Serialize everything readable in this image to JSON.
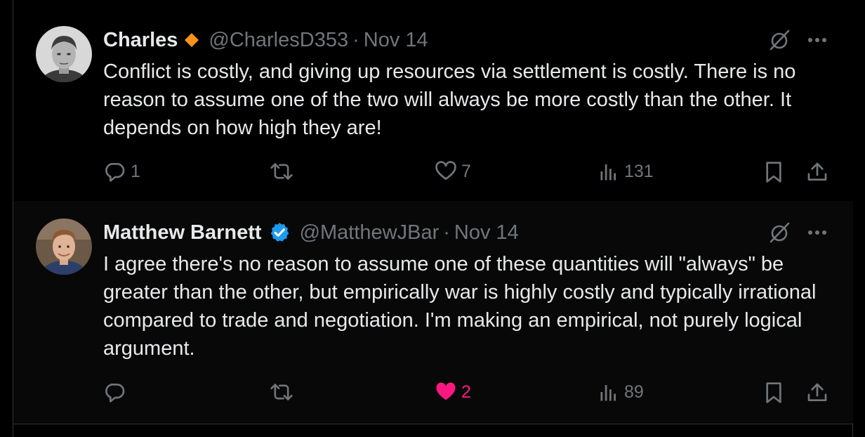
{
  "tweets": [
    {
      "name": "Charles",
      "badge": "orange-diamond-icon",
      "handle": "@CharlesD353",
      "separator": "·",
      "date": "Nov 14",
      "text": "Conflict is costly, and giving up resources via settlement is costly. There is no reason to assume one of the two will always be more costly than the other. It depends on how high they are!",
      "replies": "1",
      "reposts": "",
      "likes": "7",
      "views": "131",
      "liked": false
    },
    {
      "name": "Matthew Barnett",
      "badge": "verified-badge-icon",
      "handle": "@MatthewJBar",
      "separator": "·",
      "date": "Nov 14",
      "text": "I agree there's no reason to assume one of these quantities will \"always\" be greater than the other, but empirically war is highly costly and typically irrational compared to trade and negotiation. I'm making an empirical, not purely logical argument.",
      "replies": "",
      "reposts": "",
      "likes": "2",
      "views": "89",
      "liked": true
    }
  ],
  "colors": {
    "background": "#000000",
    "text": "#e7e9ea",
    "muted": "#71767b",
    "like_pink": "#f91880",
    "verified_blue": "#1d9bf0",
    "badge_orange": "#f7931a",
    "border": "#2f3336"
  }
}
